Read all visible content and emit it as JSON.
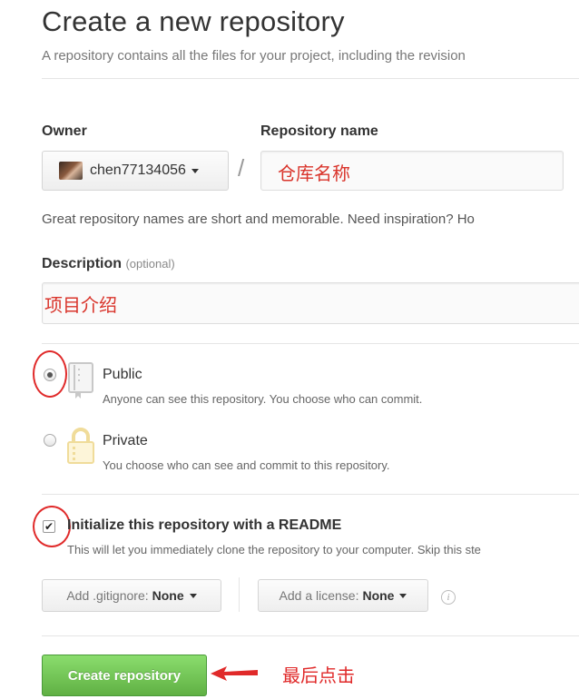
{
  "header": {
    "title": "Create a new repository",
    "subtitle": "A repository contains all the files for your project, including the revision"
  },
  "owner": {
    "label": "Owner",
    "value": "chen77134056"
  },
  "repo_name": {
    "label": "Repository name",
    "separator": "/",
    "value": "仓库名称"
  },
  "name_hint": "Great repository names are short and memorable. Need inspiration? Ho",
  "description": {
    "label": "Description",
    "optional": "(optional)",
    "value": "项目介绍"
  },
  "visibility": {
    "public": {
      "title": "Public",
      "subtitle": "Anyone can see this repository. You choose who can commit.",
      "selected": true
    },
    "private": {
      "title": "Private",
      "subtitle": "You choose who can see and commit to this repository.",
      "selected": false
    }
  },
  "init_readme": {
    "checked": true,
    "label": "Initialize this repository with a README",
    "subtitle": "This will let you immediately clone the repository to your computer. Skip this ste"
  },
  "gitignore": {
    "prefix": "Add .gitignore:",
    "value": "None"
  },
  "license": {
    "prefix": "Add a license:",
    "value": "None"
  },
  "create_button": "Create repository",
  "annotation": "最后点击",
  "colors": {
    "accent_green": "#60b044",
    "annotation_red": "#e02a2a"
  }
}
